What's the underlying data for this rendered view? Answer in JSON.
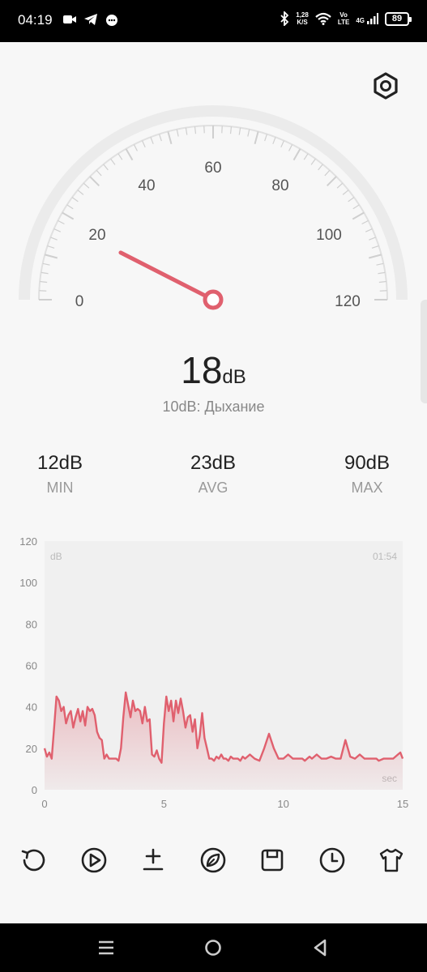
{
  "status_bar": {
    "time": "04:19",
    "speed_value": "1,28",
    "speed_unit": "K/S",
    "net_top": "Vo",
    "net_bottom": "LTE",
    "net_gen": "4G",
    "battery": "89"
  },
  "gauge": {
    "min": 0,
    "max": 120,
    "value": 18,
    "tick_labels": [
      "0",
      "20",
      "40",
      "60",
      "80",
      "100",
      "120"
    ]
  },
  "reading": {
    "value": "18",
    "unit": "dB",
    "description": "10dB: Дыхание"
  },
  "stats": {
    "min": {
      "value": "12dB",
      "label": "MIN"
    },
    "avg": {
      "value": "23dB",
      "label": "AVG"
    },
    "max": {
      "value": "90dB",
      "label": "MAX"
    }
  },
  "chart_data": {
    "type": "area",
    "ylabel": "dB",
    "xlabel": "sec",
    "duration_label": "01:54",
    "xlim": [
      0,
      15
    ],
    "ylim": [
      0,
      120
    ],
    "x_ticks": [
      "0",
      "5",
      "10",
      "15"
    ],
    "y_ticks": [
      "0",
      "20",
      "40",
      "60",
      "80",
      "100",
      "120"
    ],
    "line_color": "#e0606e",
    "x": [
      0,
      0.1,
      0.2,
      0.3,
      0.4,
      0.5,
      0.6,
      0.7,
      0.8,
      0.9,
      1.0,
      1.1,
      1.2,
      1.3,
      1.4,
      1.5,
      1.6,
      1.7,
      1.8,
      1.9,
      2.0,
      2.1,
      2.2,
      2.3,
      2.4,
      2.5,
      2.6,
      2.7,
      2.8,
      2.9,
      3.0,
      3.1,
      3.2,
      3.3,
      3.4,
      3.5,
      3.6,
      3.7,
      3.8,
      3.9,
      4.0,
      4.1,
      4.2,
      4.3,
      4.4,
      4.5,
      4.6,
      4.7,
      4.8,
      4.9,
      5.0,
      5.1,
      5.2,
      5.3,
      5.4,
      5.5,
      5.6,
      5.7,
      5.8,
      5.9,
      6.0,
      6.1,
      6.2,
      6.3,
      6.4,
      6.5,
      6.6,
      6.7,
      6.8,
      6.9,
      7.0,
      7.1,
      7.2,
      7.3,
      7.4,
      7.5,
      7.6,
      7.7,
      7.8,
      7.9,
      8.0,
      8.1,
      8.2,
      8.3,
      8.4,
      8.6,
      8.8,
      9.0,
      9.2,
      9.4,
      9.6,
      9.8,
      10.0,
      10.2,
      10.4,
      10.6,
      10.8,
      10.9,
      11.0,
      11.1,
      11.2,
      11.4,
      11.6,
      11.8,
      12.0,
      12.2,
      12.4,
      12.6,
      12.8,
      13.0,
      13.2,
      13.4,
      13.6,
      13.7,
      13.8,
      13.9,
      14.0,
      14.2,
      14.4,
      14.6,
      14.8,
      14.9,
      15.0
    ],
    "values": [
      20,
      16,
      18,
      15,
      30,
      45,
      43,
      38,
      40,
      32,
      36,
      38,
      30,
      35,
      39,
      33,
      38,
      31,
      40,
      38,
      39,
      36,
      28,
      25,
      24,
      15,
      17,
      15,
      15,
      15,
      15,
      14,
      20,
      35,
      47,
      41,
      35,
      43,
      38,
      39,
      38,
      32,
      40,
      33,
      34,
      17,
      16,
      19,
      15,
      13,
      32,
      45,
      38,
      43,
      33,
      43,
      37,
      44,
      38,
      30,
      35,
      36,
      28,
      34,
      20,
      26,
      37,
      25,
      20,
      15,
      15,
      14,
      16,
      15,
      17,
      15,
      15,
      14,
      16,
      15,
      15,
      15,
      14,
      16,
      15,
      17,
      15,
      14,
      20,
      27,
      20,
      15,
      15,
      17,
      15,
      15,
      15,
      14,
      15,
      16,
      15,
      17,
      15,
      15,
      16,
      15,
      15,
      24,
      16,
      15,
      17,
      15,
      15,
      15,
      15,
      15,
      14,
      15,
      15,
      15,
      17,
      18,
      15
    ]
  },
  "toolbar": {
    "items": [
      "reset-icon",
      "play-icon",
      "calibrate-icon",
      "eco-icon",
      "save-icon",
      "history-icon",
      "theme-icon"
    ]
  },
  "nav_bar": {
    "items": [
      "menu-icon",
      "home-icon",
      "back-icon"
    ]
  }
}
